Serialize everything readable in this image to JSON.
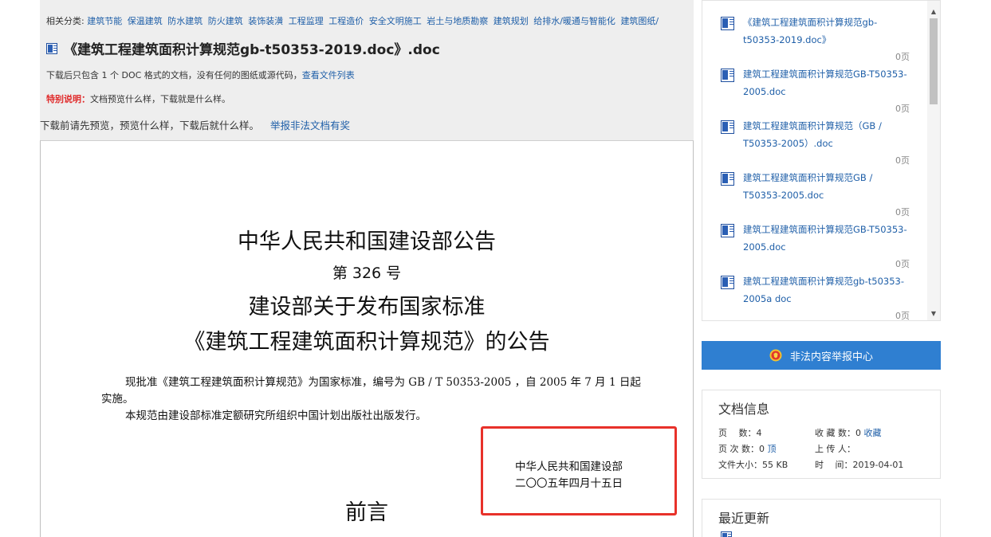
{
  "categories": {
    "label": "相关分类:",
    "links": [
      "建筑节能",
      "保温建筑",
      "防水建筑",
      "防火建筑",
      "装饰装潢",
      "工程监理",
      "工程造价",
      "安全文明施工",
      "岩土与地质勘察",
      "建筑规划",
      "给排水/暖通与智能化",
      "建筑图纸/"
    ]
  },
  "document": {
    "title": "《建筑工程建筑面积计算规范gb-t50353-2019.doc》.doc",
    "download_note": "下载后只包含 1 个 DOC 格式的文档，没有任何的图纸或源代码，",
    "file_list_link": "查看文件列表",
    "special_label": "特别说明：",
    "special_text": "文档预览什么样，下载就是什么样。",
    "preview_note": "下载前请先预览，预览什么样，下载后就什么样。",
    "report_link": "举报非法文档有奖"
  },
  "page": {
    "heading1": "中华人民共和国建设部公告",
    "heading2": "第 326 号",
    "heading3": "建设部关于发布国家标准",
    "heading4": "《建筑工程建筑面积计算规范》的公告",
    "body1": "现批准《建筑工程建筑面积计算规范》为国家标准，编号为 GB / T 50353-2005 ，自 2005 年 7 月 1 日起实施。",
    "body2": "本规范由建设部标准定额研究所组织中国计划出版社出版发行。",
    "sign1": "中华人民共和国建设部",
    "sign2": "二〇〇五年四月十五日",
    "foreword": "前言"
  },
  "related": [
    {
      "title": "《建筑工程建筑面积计算规范gb-t50353-2019.doc》",
      "pages": "0页"
    },
    {
      "title": "建筑工程建筑面积计算规范GB-T50353-2005.doc",
      "pages": "0页"
    },
    {
      "title": "建筑工程建筑面积计算规范（GB / T50353-2005）.doc",
      "pages": "0页"
    },
    {
      "title": "建筑工程建筑面积计算规范GB / T50353-2005.doc",
      "pages": "0页"
    },
    {
      "title": "建筑工程建筑面积计算规范GB-T50353-2005.doc",
      "pages": "0页"
    },
    {
      "title": "建筑工程建筑面积计算规范gb-t50353-2005a doc",
      "pages": "0页"
    }
  ],
  "report_center": "非法内容举报中心",
  "doc_info": {
    "title": "文档信息",
    "pages_label": "页　 数：",
    "pages_value": "4",
    "favorites_label": "收 藏 数：",
    "favorites_value": "0",
    "favorites_link": "收藏",
    "page_views_label": "页 次 数：",
    "page_views_value": "0",
    "page_views_link": "顶",
    "uploader_label": "上 传 人：",
    "uploader_value": "",
    "size_label": "文件大小：",
    "size_value": "55 KB",
    "time_label": "时　 间：",
    "time_value": "2019-04-01"
  },
  "recent": {
    "title": "最近更新"
  },
  "colors": {
    "link": "#1f5fa8",
    "special": "#e02a2a",
    "report_button": "#2f7fd1",
    "highlight_box": "#e8312a"
  }
}
